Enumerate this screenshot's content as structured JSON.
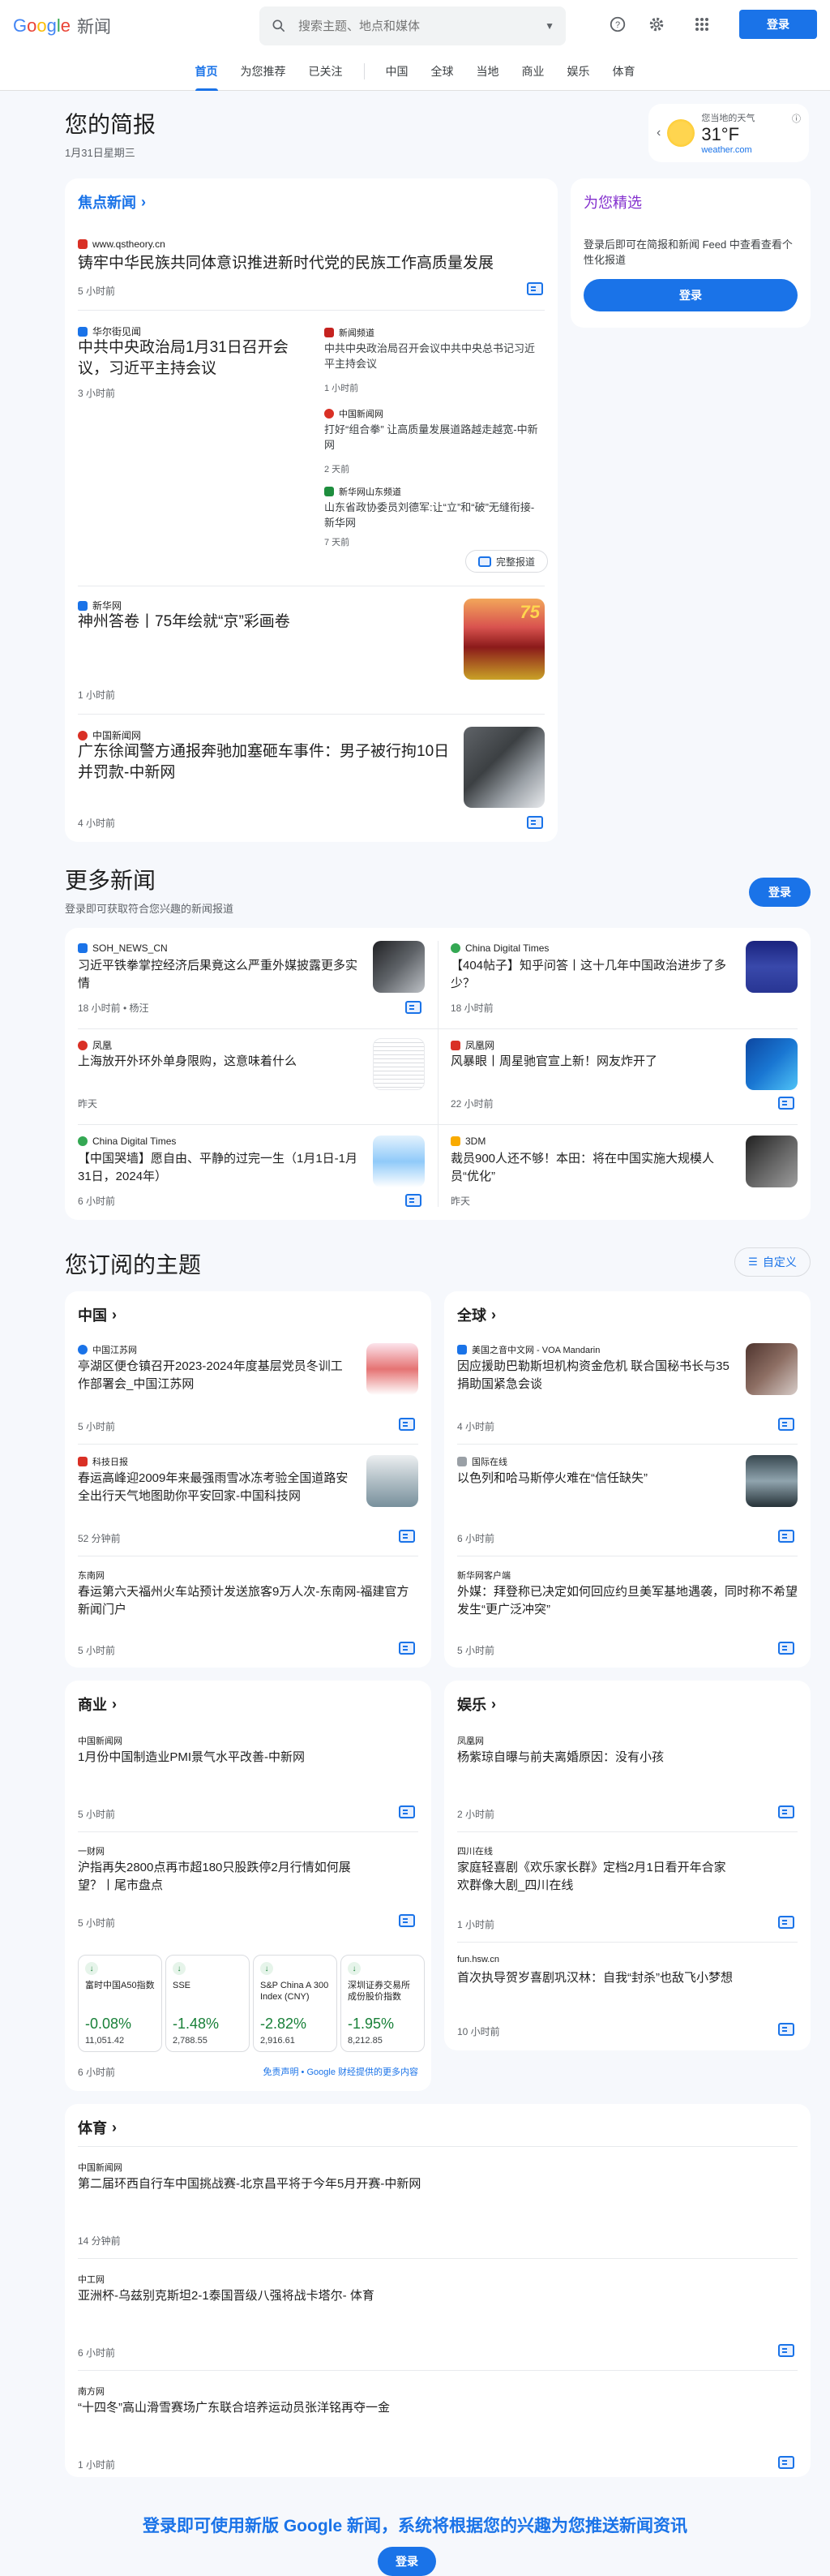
{
  "header": {
    "logo_word": "Google",
    "logo_news": "新闻",
    "search_placeholder": "搜索主题、地点和媒体",
    "login": "登录"
  },
  "nav": [
    "首页",
    "为您推荐",
    "已关注",
    "中国",
    "全球",
    "当地",
    "商业",
    "娱乐",
    "体育"
  ],
  "briefing": {
    "title": "您的简报",
    "date": "1月31日星期三"
  },
  "weather": {
    "label": "您当地的天气",
    "temp": "31°F",
    "source": "weather.com"
  },
  "top_stories": {
    "title": "焦点新闻",
    "full_coverage": "完整报道",
    "items": [
      {
        "source": "www.qstheory.cn",
        "title": "铸牢中华民族共同体意识推进新时代党的民族工作高质量发展",
        "time": "5 小时前",
        "color": "#d93025"
      },
      {
        "source": "华尔街见闻",
        "title": "中共中央政治局1月31日召开会议，习近平主持会议",
        "time": "3 小时前",
        "color": "#1a73e8"
      },
      {
        "source": "新闻频道",
        "title": "中共中央政治局召开会议中共中央总书记习近平主持会议",
        "time": "1 小时前",
        "color": "#c5221f"
      },
      {
        "source": "中国新闻网",
        "title": "打好“组合拳” 让高质量发展道路越走越宽-中新网",
        "time": "2 天前",
        "color": "#d93025"
      },
      {
        "source": "新华网山东频道",
        "title": "山东省政协委员刘德军:让“立”和“破”无缝衔接-新华网",
        "time": "7 天前",
        "color": "#1e8e3e"
      },
      {
        "source": "新华网",
        "title": "神州答卷丨75年绘就“京”彩画卷",
        "time": "1 小时前",
        "color": "#1a73e8"
      },
      {
        "source": "中国新闻网",
        "title": "广东徐闻警方通报奔驰加塞砸车事件：男子被行拘10日并罚款-中新网",
        "time": "4 小时前",
        "color": "#d93025"
      }
    ]
  },
  "picks": {
    "title": "为您精选",
    "text": "登录后即可在简报和新闻 Feed 中查看查看个性化报道",
    "button": "登录"
  },
  "more_news": {
    "title": "更多新闻",
    "sub": "登录即可获取符合您兴趣的新闻报道",
    "button": "登录",
    "items": [
      {
        "source": "SOH_NEWS_CN",
        "title": "习近平铁拳掌控经济后果竟这么严重外媒披露更多实情",
        "time": "18 小时前 • 杨汪",
        "color": "#1a73e8"
      },
      {
        "source": "China Digital Times",
        "title": "【404帖子】知乎问答丨这十几年中国政治进步了多少？",
        "time": "18 小时前",
        "color": "#34a853"
      },
      {
        "source": "凤凰",
        "title": "上海放开外环外单身限购，这意味着什么",
        "time": "昨天",
        "color": "#d93025"
      },
      {
        "source": "凤凰网",
        "title": "风暴眼丨周星驰官宣上新！网友炸开了",
        "time": "22 小时前",
        "color": "#d93025"
      },
      {
        "source": "China Digital Times",
        "title": "【中国哭墙】愿自由、平静的过完一生（1月1日-1月31日，2024年）",
        "time": "6 小时前",
        "color": "#34a853"
      },
      {
        "source": "3DM",
        "title": "裁员900人还不够！本田：将在中国实施大规模人员“优化”",
        "time": "昨天",
        "color": "#f9ab00"
      }
    ]
  },
  "subscribed": {
    "title": "您订阅的主题",
    "customize": "自定义",
    "china": {
      "title": "中国",
      "items": [
        {
          "source": "中国江苏网",
          "title": "亭湖区便仓镇召开2023-2024年度基层党员冬训工作部署会_中国江苏网",
          "time": "5 小时前",
          "color": "#1a73e8"
        },
        {
          "source": "科技日报",
          "title": "春运高峰迎2009年来最强雨雪冰冻考验全国道路安全出行天气地图助你平安回家-中国科技网",
          "time": "52 分钟前",
          "color": "#d93025"
        },
        {
          "source": "东南网",
          "title": "春运第六天福州火车站预计发送旅客9万人次-东南网-福建官方新闻门户",
          "time": "5 小时前",
          "color": "#fff"
        }
      ]
    },
    "world": {
      "title": "全球",
      "items": [
        {
          "source": "美国之音中文网 - VOA Mandarin",
          "title": "因应援助巴勒斯坦机构资金危机 联合国秘书长与35捐助国紧急会谈",
          "time": "4 小时前",
          "color": "#1a73e8"
        },
        {
          "source": "国际在线",
          "title": "以色列和哈马斯停火难在“信任缺失”",
          "time": "6 小时前",
          "color": "#9aa0a6"
        },
        {
          "source": "新华网客户端",
          "title": "外媒：拜登称已决定如何回应约旦美军基地遇袭，同时称不希望发生“更广泛冲突”",
          "time": "5 小时前",
          "color": "#fff"
        }
      ]
    },
    "business": {
      "title": "商业",
      "items": [
        {
          "source": "中国新闻网",
          "title": "1月份中国制造业PMI景气水平改善-中新网",
          "time": "5 小时前",
          "color": "#fff"
        },
        {
          "source": "一财网",
          "title": "沪指再失2800点再市超180只股跌停2月行情如何展望？丨尾市盘点",
          "time": "5 小时前",
          "color": "#fff"
        }
      ],
      "markets": [
        {
          "name": "富时中国A50指数",
          "pct": "-0.08%",
          "val": "11,051.42"
        },
        {
          "name": "SSE",
          "pct": "-1.48%",
          "val": "2,788.55"
        },
        {
          "name": "S&P China A 300 Index (CNY)",
          "pct": "-2.82%",
          "val": "2,916.61"
        },
        {
          "name": "深圳证券交易所成份股价指数",
          "pct": "-1.95%",
          "val": "8,212.85"
        }
      ],
      "market_time": "6 小时前",
      "disclaimer": "免责声明 • Google 财经提供的更多内容"
    },
    "entertainment": {
      "title": "娱乐",
      "items": [
        {
          "source": "凤凰网",
          "title": "杨紫琼自曝与前夫离婚原因：没有小孩",
          "time": "2 小时前",
          "color": "#fff"
        },
        {
          "source": "四川在线",
          "title": "家庭轻喜剧《欢乐家长群》定档2月1日看开年合家欢群像大剧_四川在线",
          "time": "1 小时前",
          "color": "#fff"
        },
        {
          "source": "fun.hsw.cn",
          "title": "首次执导贺岁喜剧巩汉林：自我“封杀”也敌飞小梦想",
          "time": "10 小时前",
          "color": "#fff"
        }
      ]
    },
    "sports": {
      "title": "体育",
      "items": [
        {
          "source": "中国新闻网",
          "title": "第二届环西自行车中国挑战赛-北京昌平将于今年5月开赛-中新网",
          "time": "14 分钟前"
        },
        {
          "source": "中工网",
          "title": "亚洲杯-乌兹别克斯坦2-1泰国晋级八强将战卡塔尔- 体育",
          "time": "6 小时前"
        },
        {
          "source": "南方网",
          "title": "“十四冬”高山滑雪赛场广东联合培养运动员张洋铭再夺一金",
          "time": "1 小时前"
        }
      ]
    }
  },
  "footer": {
    "cta": "登录即可使用新版 Google 新闻，系统将根据您的兴趣为您推送新闻资讯",
    "button": "登录"
  }
}
